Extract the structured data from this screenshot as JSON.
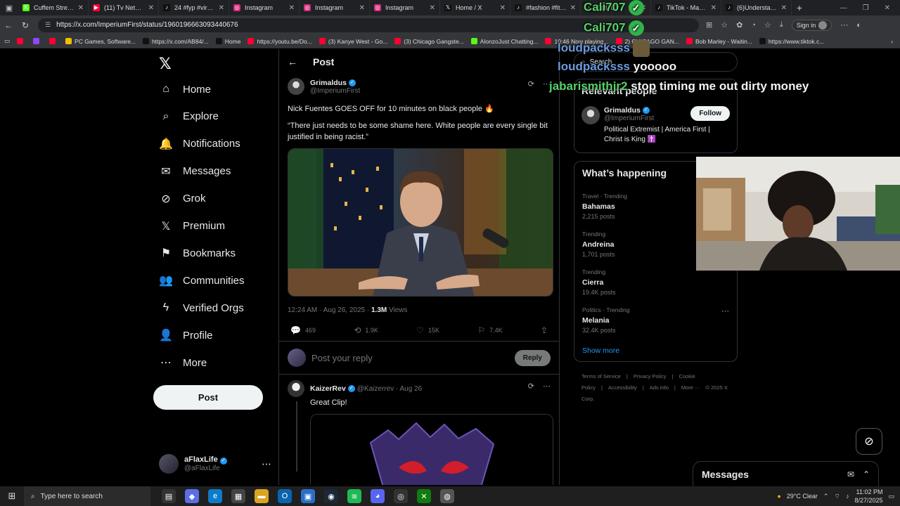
{
  "browser": {
    "tabs": [
      {
        "title": "Cuffem Stream -",
        "color": "#53fc18",
        "glyph": "K"
      },
      {
        "title": "(11) Tv Networks",
        "color": "#ff0033",
        "glyph": "▶"
      },
      {
        "title": "24 #fyp #viral #i",
        "color": "#111111",
        "glyph": "♪"
      },
      {
        "title": "Instagram",
        "color": "#d62976",
        "glyph": "◎"
      },
      {
        "title": "Instagram",
        "color": "#d62976",
        "glyph": "◎"
      },
      {
        "title": "Instagram",
        "color": "#d62976",
        "glyph": "◎"
      },
      {
        "title": "Home / X",
        "color": "#111111",
        "glyph": "𝕏"
      },
      {
        "title": "#fashion #fitinsp",
        "color": "#111111",
        "glyph": "♪"
      },
      {
        "title": "Cali707",
        "color": "#111111",
        "glyph": "♪"
      },
      {
        "title": "TikTok - Make Yo",
        "color": "#111111",
        "glyph": "♪"
      },
      {
        "title": "(6)Understandin",
        "color": "#111111",
        "glyph": "♪"
      }
    ],
    "url": "https://x.com/ImperiumFirst/status/1960196663093440676",
    "signin_label": "Sign in",
    "bookmarks": [
      {
        "label": "",
        "color": "#ff0033"
      },
      {
        "label": "",
        "color": "#9146ff"
      },
      {
        "label": "",
        "color": "#ff0033"
      },
      {
        "label": "PC Games, Software...",
        "color": "#f0c000"
      },
      {
        "label": "https://x.com/AB84/...",
        "color": "#111111"
      },
      {
        "label": "Home",
        "color": "#111111"
      },
      {
        "label": "https://youtu.be/Do...",
        "color": "#ff0033"
      },
      {
        "label": "(3) Kanye West - Go...",
        "color": "#ff0033"
      },
      {
        "label": "(3) Chicago Gangste...",
        "color": "#ff0033"
      },
      {
        "label": "AlonzoJust Chatting...",
        "color": "#53fc18"
      },
      {
        "label": "10:46 Now playing...",
        "color": "#ff0033"
      },
      {
        "label": "2) CHICAGO GAN...",
        "color": "#ff0033"
      },
      {
        "label": "Bob Marley - Waitin...",
        "color": "#ff0033"
      },
      {
        "label": "https://www.tiktok.c...",
        "color": "#111111"
      }
    ]
  },
  "nav": {
    "logo": "𝕏",
    "items": [
      {
        "label": "Home",
        "icon": "⌂",
        "name": "home"
      },
      {
        "label": "Explore",
        "icon": "⌕",
        "name": "explore"
      },
      {
        "label": "Notifications",
        "icon": "🔔",
        "name": "notifications"
      },
      {
        "label": "Messages",
        "icon": "✉",
        "name": "messages"
      },
      {
        "label": "Grok",
        "icon": "⊘",
        "name": "grok"
      },
      {
        "label": "Premium",
        "icon": "𝕏",
        "name": "premium"
      },
      {
        "label": "Bookmarks",
        "icon": "⚑",
        "name": "bookmarks"
      },
      {
        "label": "Communities",
        "icon": "👥",
        "name": "communities"
      },
      {
        "label": "Verified Orgs",
        "icon": "ϟ",
        "name": "verified-orgs"
      },
      {
        "label": "Profile",
        "icon": "👤",
        "name": "profile"
      },
      {
        "label": "More",
        "icon": "⋯",
        "name": "more"
      }
    ],
    "post_label": "Post",
    "account": {
      "name": "aFlaxLife",
      "handle": "@aFlaxLife"
    }
  },
  "main": {
    "header_title": "Post",
    "post": {
      "author": "Grimaldus",
      "handle": "@ImperiumFirst",
      "text1": "Nick Fuentes GOES OFF for 10 minutes on black people 🔥",
      "text2": "“There just needs to be some shame here. White people are every single bit justified in being racist.”",
      "timestamp": "12:24 AM · Aug 26, 2025 · ",
      "views_count": "1.3M",
      "views_label": " Views",
      "replies": "469",
      "reposts": "1.9K",
      "likes": "15K",
      "bookmarks": "7.4K"
    },
    "reply_placeholder": "Post your reply",
    "reply_button": "Reply",
    "comment": {
      "author": "KaizerRev",
      "handle_time": "@Kaizerrev · Aug 26",
      "text": "Great Clip!"
    }
  },
  "sidebar": {
    "search_placeholder": "Search",
    "relevant_title": "Relevant people",
    "relevant": {
      "name": "Grimaldus",
      "handle": "@ImperiumFirst",
      "bio": "Political Extremist | America First | Christ is King ✝️",
      "follow_label": "Follow"
    },
    "trends_title": "What’s happening",
    "trends": [
      {
        "context": "Travel · Trending",
        "name": "Bahamas",
        "posts": "2,215 posts"
      },
      {
        "context": "Trending",
        "name": "Andreina",
        "posts": "1,701 posts"
      },
      {
        "context": "Trending",
        "name": "Cierra",
        "posts": "19.4K posts"
      },
      {
        "context": "Politics · Trending",
        "name": "Melania",
        "posts": "32.4K posts"
      }
    ],
    "show_more": "Show more",
    "footer": [
      "Terms of Service",
      "|",
      "Privacy Policy",
      "|",
      "Cookie Policy",
      "|",
      "Accessibility",
      "|",
      "Ads info",
      "|",
      "More ···",
      "© 2025 X Corp."
    ]
  },
  "messages_drawer": {
    "title": "Messages"
  },
  "overlay_chat": [
    {
      "user": "Cali707",
      "text": "",
      "user_color": "#57d06b"
    },
    {
      "user": "Cali707",
      "text": "",
      "user_color": "#57d06b"
    },
    {
      "user": "loudpacksss",
      "text": "",
      "user_color": "#6b9bdc"
    },
    {
      "user": "loudpacksss",
      "text": "yooooo",
      "user_color": "#6b9bdc"
    },
    {
      "user": "jabarismithjr2",
      "text": "stop timing me out dirty money",
      "user_color": "#57d06b"
    }
  ],
  "taskbar": {
    "search_placeholder": "Type here to search",
    "weather": "29°C  Clear",
    "time": "11:02 PM",
    "date": "8/27/2025"
  }
}
